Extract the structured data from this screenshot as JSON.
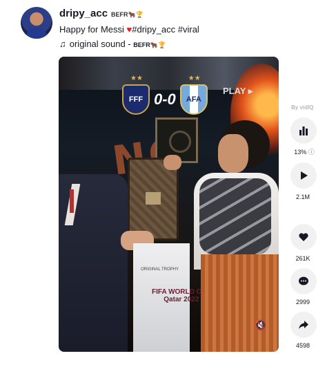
{
  "post": {
    "username": "dripy_acc",
    "nickname": "BEFR🐂🏆",
    "caption_text": "Happy for Messi ",
    "caption_heart": "♥",
    "caption_tags": "#dripy_acc #viral",
    "sound_icon": "♫",
    "sound_label": "original sound - ",
    "sound_artist": "BEFR🐂🏆"
  },
  "video": {
    "score": "0-0",
    "home_crest": "FFF",
    "away_crest": "AFA",
    "play_tag": "PLAY ▸",
    "trophy_text": "ORIGINAL TROPHY",
    "event_logo": "FIFA WORLD CUP",
    "event_sub": "Qatar 2022",
    "neon_text": "NO",
    "mute_icon": "🔇"
  },
  "sidebar": {
    "watermark": "By vidIQ",
    "stats_percent": "13%",
    "views": "2.1M",
    "likes": "261K",
    "comments": "2999",
    "shares": "4598"
  },
  "icons": {
    "stats": "bar-chart-icon",
    "play": "play-icon",
    "like": "heart-icon",
    "comment": "comment-icon",
    "share": "share-icon",
    "info": "info-icon"
  },
  "colors": {
    "heart": "#d8231f",
    "text": "#161823",
    "circle_bg": "#f1f1f2"
  }
}
